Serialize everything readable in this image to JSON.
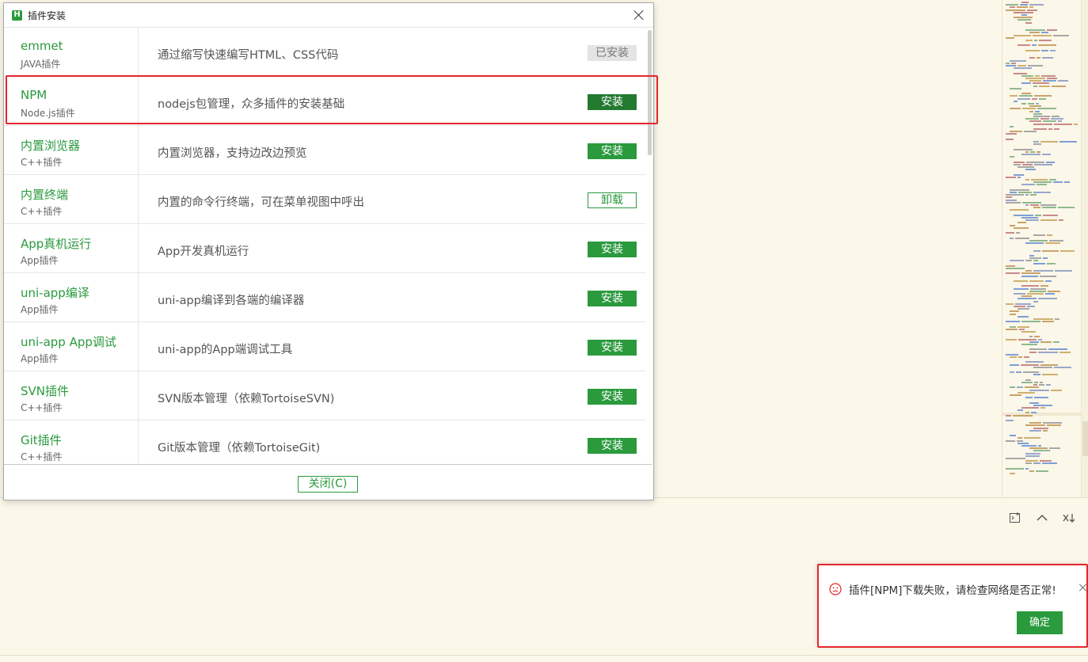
{
  "dialog": {
    "title": "插件安装",
    "close_label": "关闭(C)",
    "plugins": [
      {
        "name": "emmet",
        "type": "JAVA插件",
        "desc": "通过缩写快速编写HTML、CSS代码",
        "action": "已安装",
        "status": "installed"
      },
      {
        "name": "NPM",
        "type": "Node.js插件",
        "desc": "nodejs包管理，众多插件的安装基础",
        "action": "安装",
        "status": "install-dark"
      },
      {
        "name": "内置浏览器",
        "type": "C++插件",
        "desc": "内置浏览器，支持边改边预览",
        "action": "安装",
        "status": "install"
      },
      {
        "name": "内置终端",
        "type": "C++插件",
        "desc": "内置的命令行终端，可在菜单视图中呼出",
        "action": "卸载",
        "status": "uninstall"
      },
      {
        "name": "App真机运行",
        "type": "App插件",
        "desc": "App开发真机运行",
        "action": "安装",
        "status": "install"
      },
      {
        "name": "uni-app编译",
        "type": "App插件",
        "desc": "uni-app编译到各端的编译器",
        "action": "安装",
        "status": "install"
      },
      {
        "name": "uni-app App调试",
        "type": "App插件",
        "desc": "uni-app的App端调试工具",
        "action": "安装",
        "status": "install"
      },
      {
        "name": "SVN插件",
        "type": "C++插件",
        "desc": "SVN版本管理（依赖TortoiseSVN)",
        "action": "安装",
        "status": "install"
      },
      {
        "name": "Git插件",
        "type": "C++插件",
        "desc": "Git版本管理（依赖TortoiseGit)",
        "action": "安装",
        "status": "install"
      }
    ]
  },
  "notification": {
    "message": "插件[NPM]下载失败，请检查网络是否正常!",
    "ok_label": "确定"
  },
  "icons": {
    "app_logo": "H",
    "console_tools": [
      "new-terminal-icon",
      "chevron-up-icon",
      "clear-icon"
    ]
  },
  "colors": {
    "brand_green": "#2a9a3d",
    "highlight_red": "#e5262c",
    "editor_bg": "#fbf7e9"
  }
}
